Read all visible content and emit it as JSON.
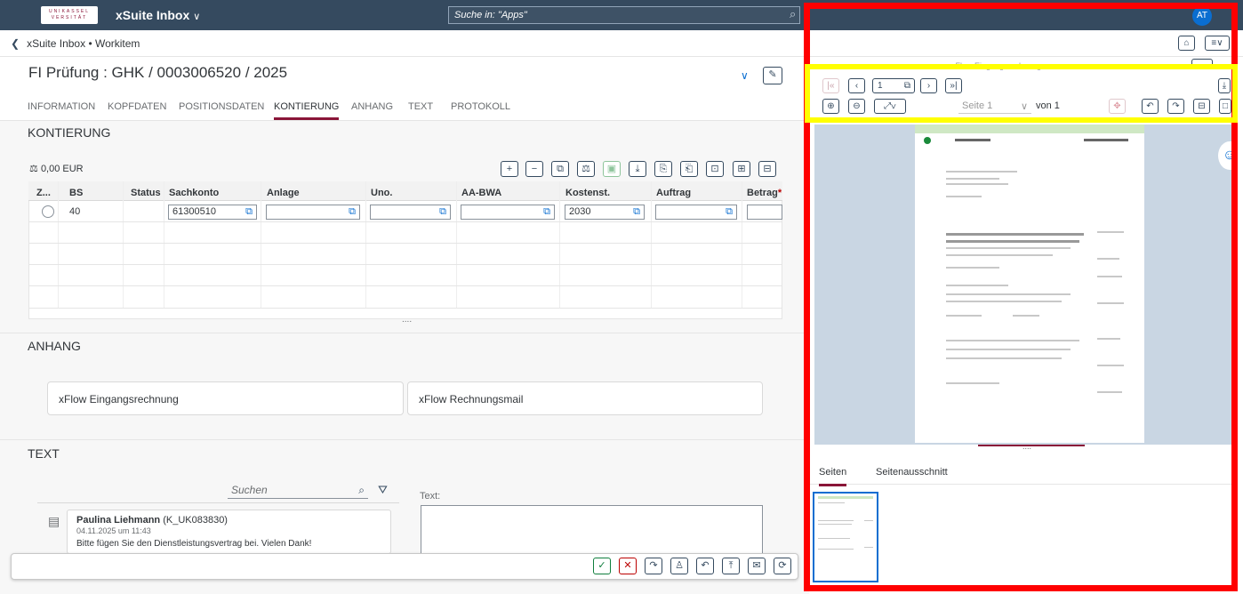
{
  "shell": {
    "logo_text": "UNIKASSEL VERSITÄT",
    "app_title": "xSuite Inbox",
    "search_placeholder": "Suche in: \"Apps\"",
    "avatar": "AT"
  },
  "breadcrumb": "xSuite Inbox • Workitem",
  "object_title": "FI Prüfung : GHK / 0003006520 / 2025",
  "tabs": [
    "INFORMATION",
    "KOPFDATEN",
    "POSITIONSDATEN",
    "KONTIERUNG",
    "ANHANG",
    "TEXT",
    "PROTOKOLL"
  ],
  "kontierung": {
    "title": "KONTIERUNG",
    "sum": "0,00 EUR",
    "columns": [
      "Z...",
      "BS",
      "Status",
      "Sachkonto",
      "Anlage",
      "Uno.",
      "AA-BWA",
      "Kostenst.",
      "Auftrag",
      "Betrag"
    ],
    "required_marker": "*",
    "row": {
      "bs": "40",
      "sachkonto": "61300510",
      "kostenst": "2030"
    },
    "more": "...."
  },
  "anhang": {
    "title": "ANHANG",
    "cards": [
      "xFlow Eingangsrechnung",
      "xFlow Rechnungsmail"
    ]
  },
  "text_section": {
    "title": "TEXT",
    "search_placeholder": "Suchen",
    "text_label": "Text:",
    "comment_author": "Paulina Liehmann",
    "comment_user": "(K_UK083830)",
    "comment_date": "04.11.2025 um 11:43",
    "comment_body": "Bitte fügen Sie den Dienstleistungsvertrag bei. Vielen Dank!"
  },
  "viewer": {
    "page_input": "1",
    "page_label": "Seite 1",
    "of_label": "von 1",
    "doc_label": "xFlow Eingangsrechnung",
    "tab_pages": "Seiten",
    "tab_section": "Seitenausschnitt",
    "divider": "...."
  }
}
